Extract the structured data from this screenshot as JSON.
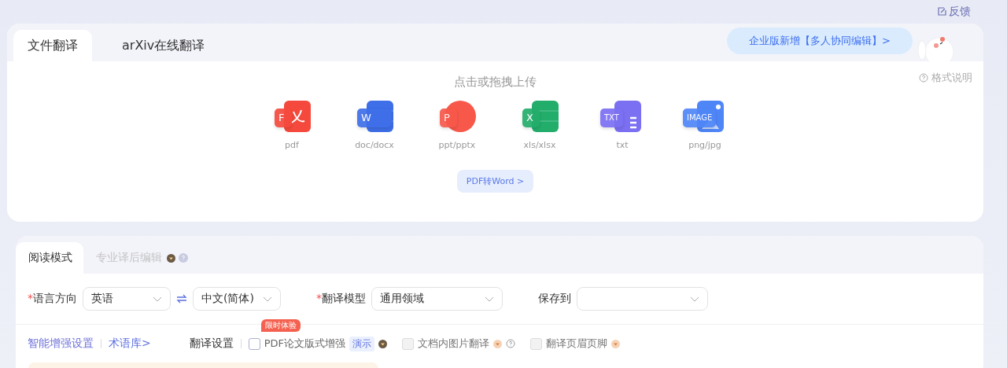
{
  "feedback": {
    "label": "反馈"
  },
  "upload_card": {
    "tabs": [
      {
        "label": "文件翻译",
        "selected": true
      },
      {
        "label": "arXiv在线翻译",
        "selected": false
      }
    ],
    "promo": "企业版新增【多人协同编辑】>",
    "format_help": "格式说明",
    "prompt": "点击或拖拽上传",
    "file_types": [
      {
        "kind": "pdf",
        "badge": "F",
        "label": "pdf",
        "color": "#f5493d"
      },
      {
        "kind": "doc",
        "badge": "W",
        "label": "doc/docx",
        "color": "#3e6ee8"
      },
      {
        "kind": "ppt",
        "badge": "P",
        "label": "ppt/pptx",
        "color": "#f7584a"
      },
      {
        "kind": "xls",
        "badge": "X",
        "label": "xls/xlsx",
        "color": "#22ad6b"
      },
      {
        "kind": "txt",
        "badge": "TXT",
        "label": "txt",
        "color": "#7b6ff2"
      },
      {
        "kind": "img",
        "badge": "IMAGE",
        "label": "png/jpg",
        "color": "#4f86f7"
      }
    ],
    "convert_button": "PDF转Word >"
  },
  "settings_card": {
    "tabs": [
      {
        "label": "阅读模式",
        "selected": true,
        "premium": false
      },
      {
        "label": "专业译后编辑",
        "selected": false,
        "premium": true
      }
    ],
    "fields": [
      {
        "label": "语言方向",
        "required_mark": "*",
        "selects": [
          "英语",
          "中文(简体)"
        ]
      },
      {
        "label": "翻译模型",
        "required_mark": "*",
        "selects": [
          "通用领域"
        ]
      },
      {
        "label": "保存到"
      }
    ],
    "links": [
      "智能增强设置",
      "术语库>"
    ],
    "options_label": "翻译设置",
    "options": [
      {
        "label": "PDF论文版式增强",
        "checked": false,
        "disabled": false,
        "ribbon": "限时体验",
        "tag": "演示",
        "help": false
      },
      {
        "label": "文档内图片翻译",
        "checked": false,
        "disabled": true,
        "help": true
      },
      {
        "label": "翻译页眉页脚",
        "checked": false,
        "disabled": true,
        "help": false
      }
    ]
  }
}
